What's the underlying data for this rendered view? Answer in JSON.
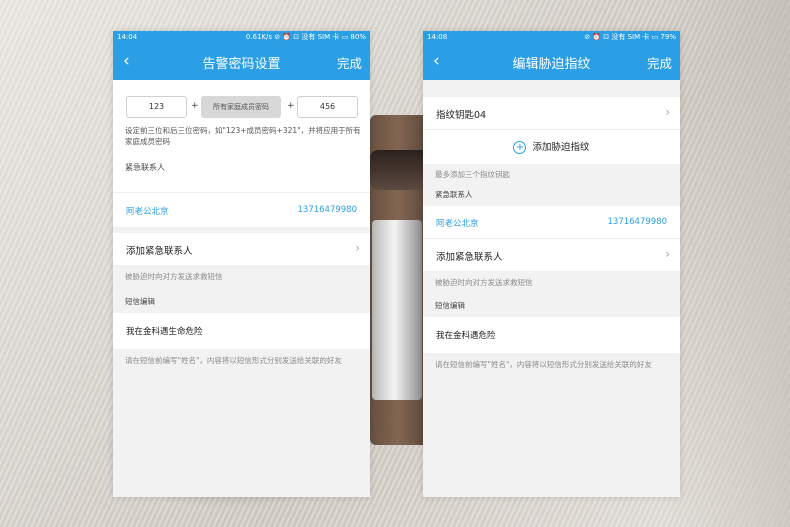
{
  "left": {
    "status": {
      "time": "14:04",
      "info": "0.61K/s ⊘ ⏰ ⊡ 没有 SIM 卡 ▭ 80%"
    },
    "nav": {
      "back": "‹",
      "title": "告警密码设置",
      "done": "完成"
    },
    "password": {
      "prefix_value": "123",
      "middle_label": "所有家庭成员密码",
      "suffix_value": "456",
      "plus": "+",
      "hint": "设定前三位和后三位密码，如\"123+成员密码+321\"，并将应用于所有家庭成员密码"
    },
    "contacts_label": "紧急联系人",
    "contact": {
      "name": "阿老公北京",
      "phone": "13716479980"
    },
    "add_contact": "添加紧急联系人",
    "sms_hint": "被胁迫时向对方发送求救短信",
    "sms_label": "短信编辑",
    "sms_text": "我在金科遇生命危险",
    "sms_note": "请在短信前编写\"姓名\"，内容将以短信形式分别发送给关联的好友"
  },
  "right": {
    "status": {
      "time": "14:08",
      "info": "⊘ ⏰ ⊡ 没有 SIM 卡 ▭ 79%"
    },
    "nav": {
      "back": "‹",
      "title": "编辑胁迫指纹",
      "done": "完成"
    },
    "fingerprint_key": "指纹钥匙04",
    "add_fingerprint": "添加胁迫指纹",
    "fingerprint_hint": "最多添加三个指纹钥匙",
    "contacts_label": "紧急联系人",
    "contact": {
      "name": "阿老公北京",
      "phone": "13716479980"
    },
    "add_contact": "添加紧急联系人",
    "sms_hint": "被胁迫时向对方发送求救短信",
    "sms_label": "短信编辑",
    "sms_text": "我在金科遇危险",
    "sms_note": "请在短信前编写\"姓名\"，内容将以短信形式分别发送给关联的好友"
  },
  "icons": {
    "chevron": "›",
    "plus": "+"
  },
  "colors": {
    "accent": "#2a9fe6",
    "background": "#f2f2f2"
  }
}
